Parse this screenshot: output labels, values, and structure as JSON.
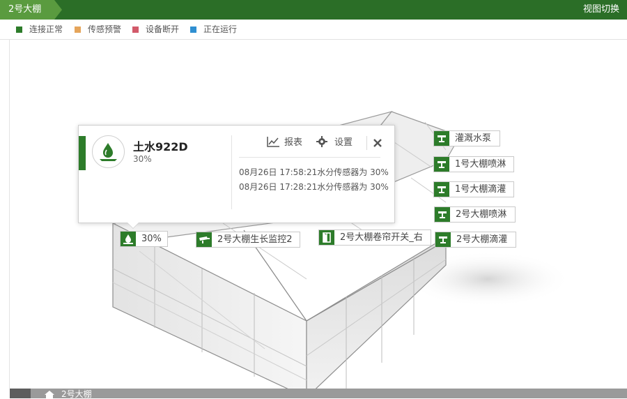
{
  "header": {
    "breadcrumb": "2号大棚",
    "view_switch": "视图切换"
  },
  "legend": [
    {
      "label": "连接正常",
      "color": "#2d7c2a"
    },
    {
      "label": "传感预警",
      "color": "#e5a55b"
    },
    {
      "label": "设备断开",
      "color": "#d25a6a"
    },
    {
      "label": "正在运行",
      "color": "#2f8fd1"
    }
  ],
  "devices": {
    "pump": {
      "label": "灌溉水泵",
      "icon": "valve-icon"
    },
    "spray1": {
      "label": "1号大棚喷淋",
      "icon": "valve-icon"
    },
    "drip1": {
      "label": "1号大棚滴灌",
      "icon": "valve-icon"
    },
    "spray2": {
      "label": "2号大棚喷淋",
      "icon": "valve-icon"
    },
    "drip2": {
      "label": "2号大棚滴灌",
      "icon": "valve-icon"
    },
    "camera": {
      "label": "2号大棚生长监控2",
      "icon": "camera-icon"
    },
    "curtain": {
      "label": "2号大棚卷帘开关_右",
      "icon": "door-icon"
    },
    "soil": {
      "label": "30%",
      "icon": "water-drop-icon"
    }
  },
  "popup": {
    "name": "土水922D",
    "value": "30%",
    "report_label": "报表",
    "settings_label": "设置",
    "logs": [
      "08月26日 17:58:21水分传感器为 30%",
      "08月26日 17:28:21水分传感器为 30%"
    ]
  },
  "footer": {
    "label": "2号大棚"
  }
}
